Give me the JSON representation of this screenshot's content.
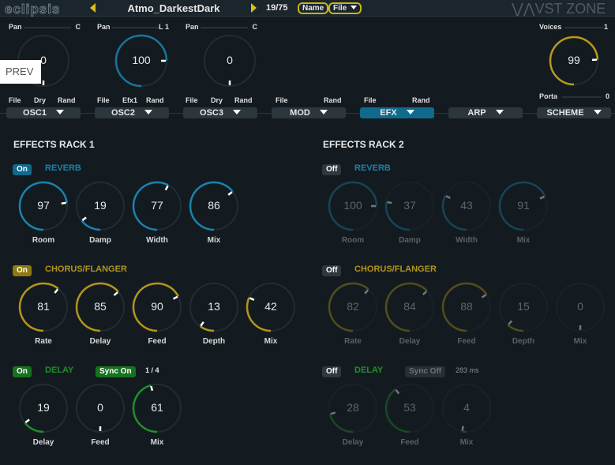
{
  "header": {
    "logo": "eclipsis",
    "preset_name": "Atmo_DarkestDark",
    "preset_count": "19/75",
    "name_btn": "Name",
    "file_btn": "File",
    "brand": "VST ZONE",
    "prev_overlay": "PREV"
  },
  "oscs": [
    {
      "pan_label": "Pan",
      "pan_value": "C",
      "level": 0,
      "links": [
        "File",
        "Dry",
        "Rand"
      ],
      "tab": "OSC1"
    },
    {
      "pan_label": "Pan",
      "pan_value": "L 1",
      "level": 100,
      "links": [
        "File",
        "Efx1",
        "Rand"
      ],
      "tab": "OSC2"
    },
    {
      "pan_label": "Pan",
      "pan_value": "C",
      "level": 0,
      "links": [
        "File",
        "Dry",
        "Rand"
      ],
      "tab": "OSC3"
    }
  ],
  "voices": {
    "label": "Voices",
    "value": "1",
    "knob": 99,
    "porta_label": "Porta",
    "porta_value": "0"
  },
  "tabs": [
    {
      "label": "MOD",
      "links": [
        "File",
        "Rand"
      ]
    },
    {
      "label": "EFX",
      "links": [
        "File",
        "Rand"
      ],
      "active": true
    },
    {
      "label": "ARP"
    },
    {
      "label": "SCHEME"
    }
  ],
  "colors": {
    "reverb": "#1a82ad",
    "chorus": "#b3951c",
    "delay": "#1f8f2c",
    "osc": "#17769a",
    "voices": "#b89a1a"
  },
  "racks": [
    {
      "title": "EFFECTS RACK 1",
      "reverb": {
        "toggle": "On",
        "name": "REVERB",
        "knobs": [
          {
            "label": "Room",
            "value": 97
          },
          {
            "label": "Damp",
            "value": 19
          },
          {
            "label": "Width",
            "value": 77
          },
          {
            "label": "Mix",
            "value": 86
          }
        ]
      },
      "chorus": {
        "toggle": "On",
        "name": "CHORUS/FLANGER",
        "knobs": [
          {
            "label": "Rate",
            "value": 81
          },
          {
            "label": "Delay",
            "value": 85
          },
          {
            "label": "Feed",
            "value": 90
          },
          {
            "label": "Depth",
            "value": 13
          },
          {
            "label": "Mix",
            "value": 42
          }
        ]
      },
      "delay": {
        "toggle": "On",
        "name": "DELAY",
        "sync": "Sync On",
        "time": "1 / 4",
        "knobs": [
          {
            "label": "Delay",
            "value": 19
          },
          {
            "label": "Feed",
            "value": 0
          },
          {
            "label": "Mix",
            "value": 61
          }
        ]
      }
    },
    {
      "title": "EFFECTS RACK 2",
      "reverb": {
        "toggle": "Off",
        "name": "REVERB",
        "knobs": [
          {
            "label": "Room",
            "value": 100
          },
          {
            "label": "Damp",
            "value": 37
          },
          {
            "label": "Width",
            "value": 43
          },
          {
            "label": "Mix",
            "value": 91
          }
        ]
      },
      "chorus": {
        "toggle": "Off",
        "name": "CHORUS/FLANGER",
        "knobs": [
          {
            "label": "Rate",
            "value": 82
          },
          {
            "label": "Delay",
            "value": 84
          },
          {
            "label": "Feed",
            "value": 88
          },
          {
            "label": "Depth",
            "value": 15
          },
          {
            "label": "Mix",
            "value": 0
          }
        ]
      },
      "delay": {
        "toggle": "Off",
        "name": "DELAY",
        "sync": "Sync Off",
        "time": "283 ms",
        "knobs": [
          {
            "label": "Delay",
            "value": 28
          },
          {
            "label": "Feed",
            "value": 53
          },
          {
            "label": "Mix",
            "value": 4
          }
        ]
      }
    }
  ]
}
